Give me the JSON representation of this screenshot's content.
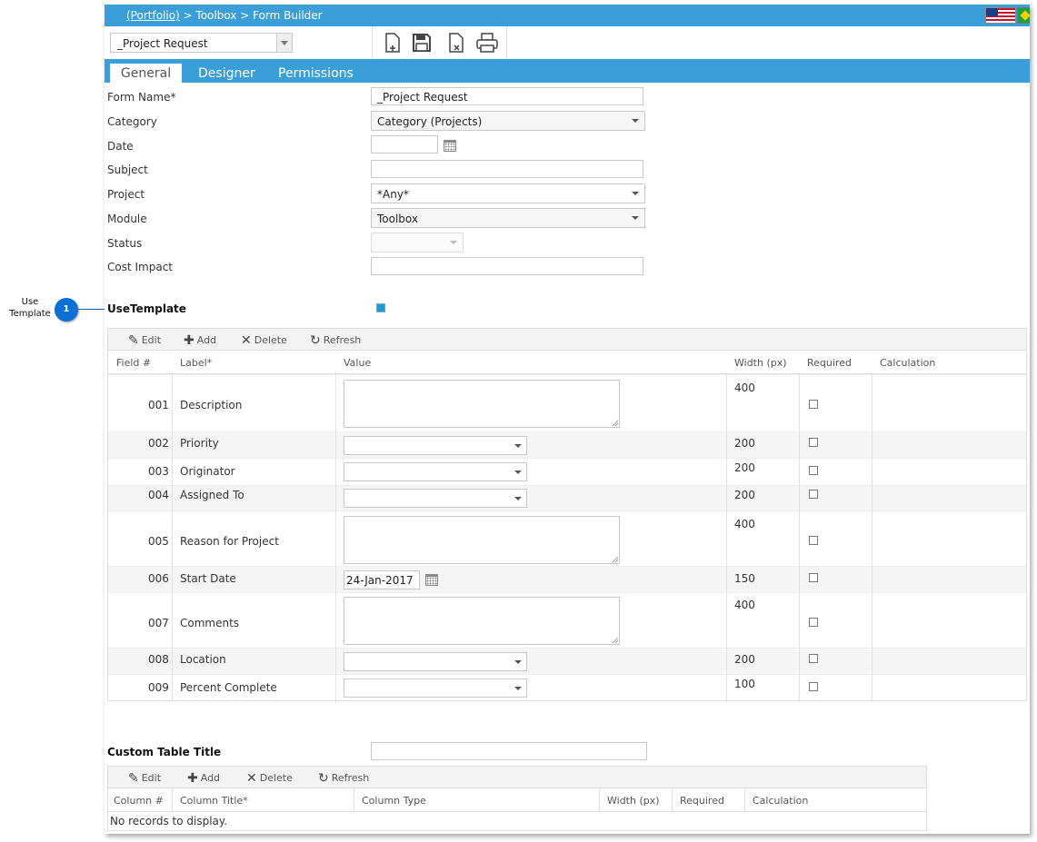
{
  "breadcrumb": {
    "link": "(Portfolio)",
    "rest": " > Toolbox > Form Builder"
  },
  "form_selector": {
    "value": "_Project Request"
  },
  "toolbar_icons": [
    "new-form-icon",
    "save-icon",
    "delete-form-icon",
    "print-icon"
  ],
  "tabs": [
    {
      "label": "General",
      "active": true
    },
    {
      "label": "Designer",
      "active": false
    },
    {
      "label": "Permissions",
      "active": false
    }
  ],
  "fields": {
    "form_name": {
      "label": "Form Name*",
      "value": "_Project Request"
    },
    "category": {
      "label": "Category",
      "value": "Category (Projects)"
    },
    "date": {
      "label": "Date",
      "value": ""
    },
    "subject": {
      "label": "Subject",
      "value": ""
    },
    "project": {
      "label": "Project",
      "value": "*Any*"
    },
    "module": {
      "label": "Module",
      "value": "Toolbox"
    },
    "status": {
      "label": "Status",
      "value": ""
    },
    "cost_impact": {
      "label": "Cost Impact",
      "value": ""
    }
  },
  "use_template": {
    "label": "UseTemplate",
    "checked": true
  },
  "grid_toolbar": {
    "edit": "Edit",
    "add": "Add",
    "delete": "Delete",
    "refresh": "Refresh"
  },
  "template_grid": {
    "headers": {
      "field": "Field #",
      "label": "Label*",
      "value": "Value",
      "width": "Width (px)",
      "required": "Required",
      "calculation": "Calculation"
    },
    "rows": [
      {
        "num": "001",
        "label": "Description",
        "width": "400",
        "type": "textarea",
        "value": ""
      },
      {
        "num": "002",
        "label": "Priority",
        "width": "200",
        "type": "select",
        "value": ""
      },
      {
        "num": "003",
        "label": "Originator",
        "width": "200",
        "type": "select",
        "value": ""
      },
      {
        "num": "004",
        "label": "Assigned To",
        "width": "200",
        "type": "select",
        "value": ""
      },
      {
        "num": "005",
        "label": "Reason for Project",
        "width": "400",
        "type": "textarea",
        "value": ""
      },
      {
        "num": "006",
        "label": "Start Date",
        "width": "150",
        "type": "date",
        "value": "24-Jan-2017"
      },
      {
        "num": "007",
        "label": "Comments",
        "width": "400",
        "type": "textarea",
        "value": ""
      },
      {
        "num": "008",
        "label": "Location",
        "width": "200",
        "type": "select",
        "value": ""
      },
      {
        "num": "009",
        "label": "Percent Complete",
        "width": "100",
        "type": "select",
        "value": ""
      }
    ]
  },
  "custom_table": {
    "title_label": "Custom Table Title",
    "title_value": "",
    "headers": {
      "column": "Column #",
      "title": "Column Title*",
      "type": "Column Type",
      "width": "Width (px)",
      "required": "Required",
      "calculation": "Calculation"
    },
    "empty_text": "No records to display."
  },
  "callout": {
    "number": "1",
    "text": "Use Template"
  },
  "colors": {
    "header_blue": "#3a9ed8",
    "badge_blue": "#0b6fd6"
  }
}
